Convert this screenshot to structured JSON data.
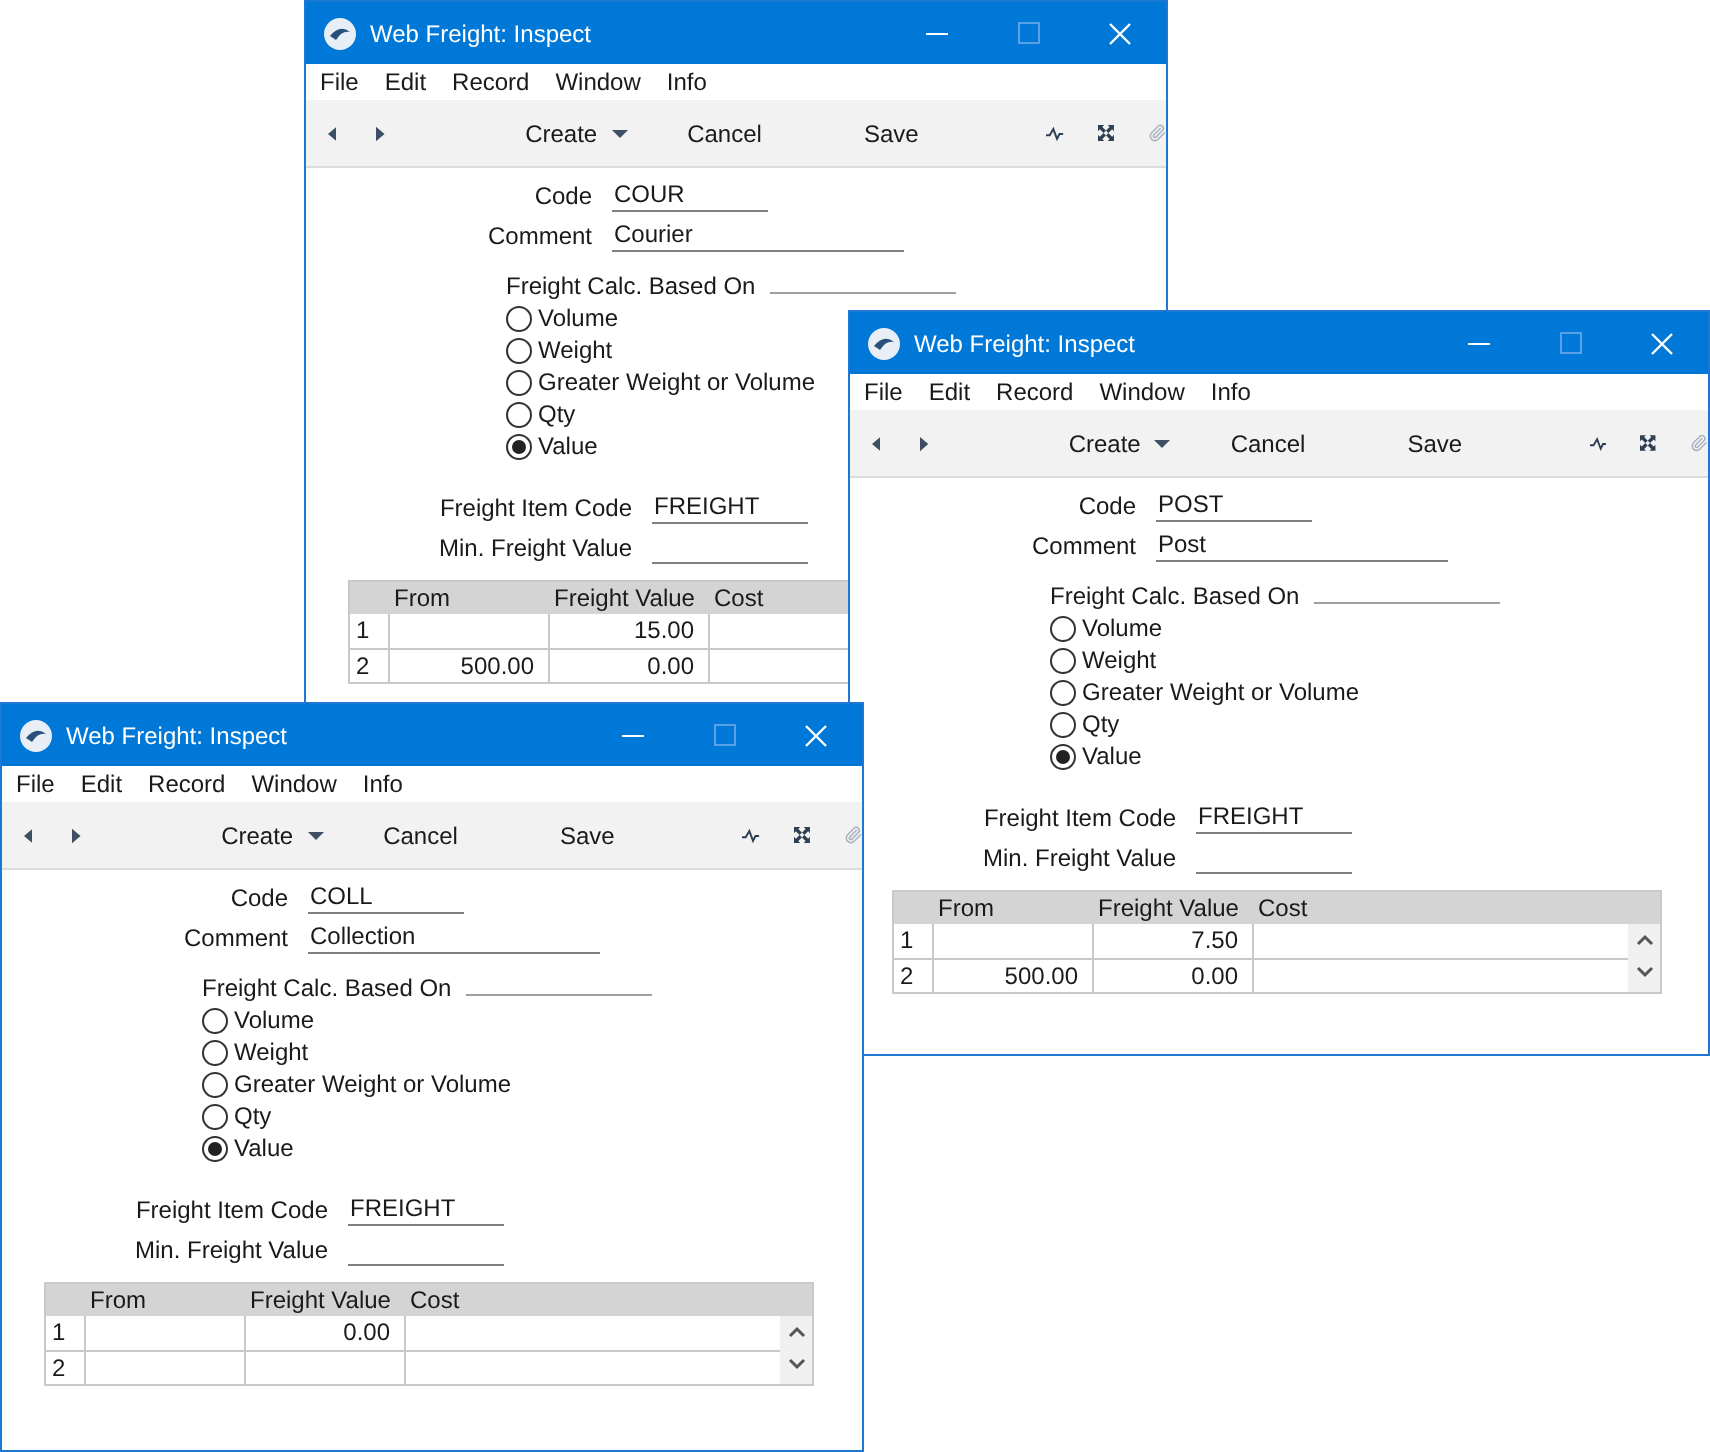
{
  "windows": [
    {
      "title": "Web Freight: Inspect",
      "menu": [
        "File",
        "Edit",
        "Record",
        "Window",
        "Info"
      ],
      "toolbar": {
        "create": "Create",
        "cancel": "Cancel",
        "save": "Save"
      },
      "form": {
        "code_label": "Code",
        "code": "COUR",
        "comment_label": "Comment",
        "comment": "Courier",
        "calc_label": "Freight Calc. Based On",
        "options": [
          {
            "label": "Volume",
            "selected": false
          },
          {
            "label": "Weight",
            "selected": false
          },
          {
            "label": "Greater Weight or Volume",
            "selected": false
          },
          {
            "label": "Qty",
            "selected": false
          },
          {
            "label": "Value",
            "selected": true
          }
        ],
        "item_code_label": "Freight Item Code",
        "item_code": "FREIGHT",
        "min_value_label": "Min. Freight Value"
      },
      "table": {
        "columns": [
          "From",
          "Freight Value",
          "Cost"
        ],
        "rows": [
          {
            "number": "1",
            "freight_value": "15.00"
          },
          {
            "number": "2",
            "from": "500.00",
            "freight_value": "0.00"
          }
        ]
      }
    },
    {
      "title": "Web Freight: Inspect",
      "menu": [
        "File",
        "Edit",
        "Record",
        "Window",
        "Info"
      ],
      "toolbar": {
        "create": "Create",
        "cancel": "Cancel",
        "save": "Save"
      },
      "form": {
        "code_label": "Code",
        "code": "POST",
        "comment_label": "Comment",
        "comment": "Post",
        "calc_label": "Freight Calc. Based On",
        "options": [
          {
            "label": "Volume",
            "selected": false
          },
          {
            "label": "Weight",
            "selected": false
          },
          {
            "label": "Greater Weight or Volume",
            "selected": false
          },
          {
            "label": "Qty",
            "selected": false
          },
          {
            "label": "Value",
            "selected": true
          }
        ],
        "item_code_label": "Freight Item Code",
        "item_code": "FREIGHT",
        "min_value_label": "Min. Freight Value"
      },
      "table": {
        "columns": [
          "From",
          "Freight Value",
          "Cost"
        ],
        "rows": [
          {
            "number": "1",
            "freight_value": "7.50"
          },
          {
            "number": "2",
            "from": "500.00",
            "freight_value": "0.00"
          }
        ],
        "scroll_arrows": true
      }
    },
    {
      "title": "Web Freight: Inspect",
      "menu": [
        "File",
        "Edit",
        "Record",
        "Window",
        "Info"
      ],
      "toolbar": {
        "create": "Create",
        "cancel": "Cancel",
        "save": "Save"
      },
      "form": {
        "code_label": "Code",
        "code": "COLL",
        "comment_label": "Comment",
        "comment": "Collection",
        "calc_label": "Freight Calc. Based On",
        "options": [
          {
            "label": "Volume",
            "selected": false
          },
          {
            "label": "Weight",
            "selected": false
          },
          {
            "label": "Greater Weight or Volume",
            "selected": false
          },
          {
            "label": "Qty",
            "selected": false
          },
          {
            "label": "Value",
            "selected": true
          }
        ],
        "item_code_label": "Freight Item Code",
        "item_code": "FREIGHT",
        "min_value_label": "Min. Freight Value"
      },
      "table": {
        "columns": [
          "From",
          "Freight Value",
          "Cost"
        ],
        "rows": [
          {
            "number": "1",
            "freight_value": "0.00"
          },
          {
            "number": "2"
          }
        ],
        "scroll_arrows": true
      }
    }
  ]
}
